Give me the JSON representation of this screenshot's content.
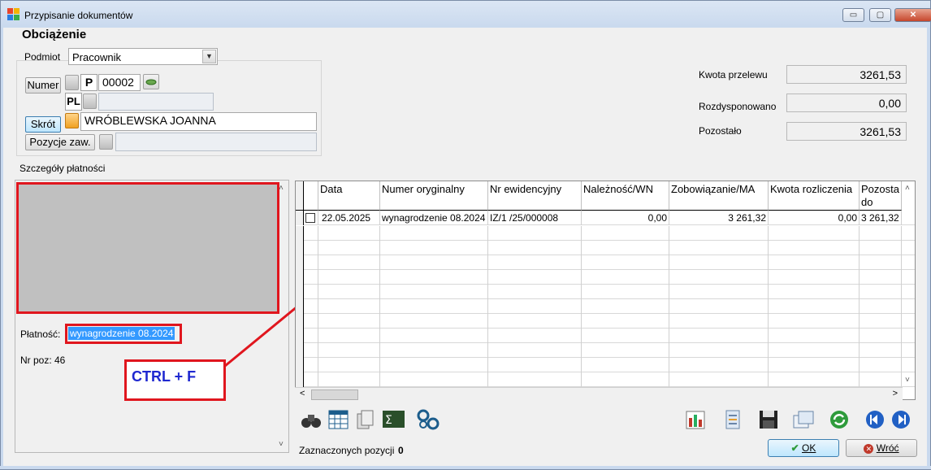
{
  "window": {
    "title": "Przypisanie dokumentów",
    "min_glyph": "▭",
    "max_glyph": "▢",
    "close_glyph": "✕"
  },
  "form": {
    "heading": "Obciążenie",
    "podmiot_label": "Podmiot",
    "podmiot_value": "Pracownik",
    "numer_button": "Numer",
    "numer_prefix": "P",
    "numer_value": "00002",
    "pl_label": "PL",
    "pl_value": "",
    "skrot_button": "Skrót",
    "skrot_value": "WRÓBLEWSKA JOANNA",
    "pozycje_button": "Pozycje zaw.",
    "pozycje_value": ""
  },
  "amounts": {
    "kwota_label": "Kwota przelewu",
    "kwota_value": "3261,53",
    "rozdysponowano_label": "Rozdysponowano",
    "rozdysponowano_value": "0,00",
    "pozostalo_label": "Pozostało",
    "pozostalo_value": "3261,53"
  },
  "details": {
    "section_label": "Szczegóły płatności",
    "platnosc_label": "Płatność:",
    "platnosc_value": "wynagrodzenie 08.2024",
    "nrpoz_label": "Nr poz: 46"
  },
  "annotation": {
    "callout_text": "CTRL + F",
    "color": "#e0161e"
  },
  "grid": {
    "columns": [
      "Data",
      "Numer oryginalny",
      "Nr ewidencyjny",
      "Należność/WN",
      "Zobowiązanie/MA",
      "Kwota rozliczenia",
      "Pozosta do"
    ],
    "rows": [
      {
        "data": "22.05.2025",
        "numer": "wynagrodzenie 08.2024",
        "nrew": "IZ/1  /25/000008",
        "naleznosc": "0,00",
        "zobowiazanie": "3 261,32",
        "kwota": "0,00",
        "pozostalo": "3 261,32"
      }
    ]
  },
  "toolbar": {
    "icons": [
      "binoculars-icon",
      "calendar-grid-icon",
      "document-stack-icon",
      "sum-icon",
      "settings-gears-icon",
      "chart-icon",
      "clipboard-icon",
      "save-icon",
      "windows-icon",
      "refresh-icon",
      "prev-icon",
      "next-icon"
    ]
  },
  "footer": {
    "zaznaczonych_label": "Zaznaczonych pozycji",
    "zaznaczonych_value": "0",
    "ok_label": "OK",
    "cancel_label": "Wróć"
  }
}
